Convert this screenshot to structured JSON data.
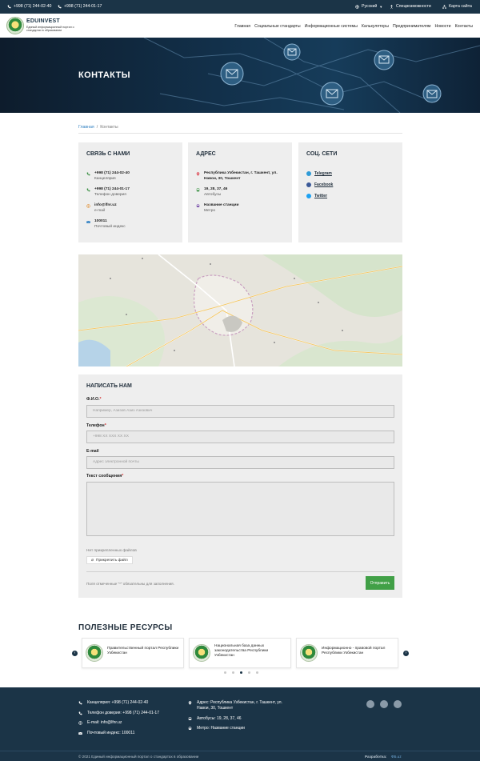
{
  "topbar": {
    "phone1": "+998 (71) 244-02-40",
    "phone2": "+998 (71) 244-01-17",
    "language": "Русский",
    "accessibility": "Спецвозможности",
    "sitemap": "Карта сайта"
  },
  "header": {
    "brand": "EDUINVEST",
    "subtitle": "Единый информационный портал о стандартах в образовании",
    "nav": [
      "Главная",
      "Социальные стандарты",
      "Информационные системы",
      "Калькуляторы",
      "Предпринимателям",
      "Новости",
      "Контакты"
    ]
  },
  "hero": {
    "title": "КОНТАКТЫ"
  },
  "breadcrumb": {
    "home": "Главная",
    "separator": "/",
    "current": "Контакты"
  },
  "contact_card": {
    "title": "СВЯЗЬ С НАМИ",
    "rows": [
      {
        "main": "+998 (71) 244-02-40",
        "sub": "Канцелярия",
        "icon": "phone-icon"
      },
      {
        "main": "+998 (71) 244-01-17",
        "sub": "Телефон доверия",
        "icon": "phone-icon"
      },
      {
        "main": "info@lfnr.uz",
        "sub": "e-mail",
        "icon": "at-icon"
      },
      {
        "main": "100011",
        "sub": "Почтовый индекс",
        "icon": "mail-icon"
      }
    ]
  },
  "address_card": {
    "title": "АДРЕС",
    "rows": [
      {
        "main": "Республика Узбекистан, г. Ташкент, ул. Навои, 30, Тошкент",
        "sub": "",
        "icon": "map-pin-icon"
      },
      {
        "main": "19, 28, 37, 46",
        "sub": "Автобусы",
        "icon": "bus-icon"
      },
      {
        "main": "Название станции",
        "sub": "Метро",
        "icon": "metro-icon"
      }
    ]
  },
  "social_card": {
    "title": "СОЦ. СЕТИ",
    "links": [
      {
        "label": "Telegram",
        "color": "#2f9bd7",
        "icon": "telegram-icon"
      },
      {
        "label": "Facebook",
        "color": "#3b5998",
        "icon": "facebook-icon"
      },
      {
        "label": "Twitter",
        "color": "#1da1f2",
        "icon": "twitter-icon"
      }
    ]
  },
  "form": {
    "title": "НАПИСАТЬ НАМ",
    "name_label": "Ф.И.О.",
    "name_placeholder": "Например, Азизов Азиз Азизович",
    "phone_label": "Телефон",
    "phone_placeholder": "+998 XX XXX XX XX",
    "email_label": "E-mail",
    "email_placeholder": "Адрес электронной почты",
    "message_label": "Текст сообщения",
    "required_mark": "*",
    "files_label": "Нет прикрепленных файлов",
    "attach_label": "Прикрепить файл",
    "note": "Поля отмеченные \"*\" обязательны для заполнения.",
    "submit_label": "Отправить"
  },
  "resources": {
    "title": "ПОЛЕЗНЫЕ РЕСУРСЫ",
    "items": [
      "Правительственный портал Республики Узбекистан",
      "Национальная база данных законодательства Республики Узбекистан",
      "Информационно - правовой портал Республики Узбекистан"
    ],
    "pager_active_index": 2,
    "pager_count": 5
  },
  "footer": {
    "office": "Канцелярия: +998 (71) 244-02-40",
    "trust": "Телефон доверия: +998 (71) 244-01-17",
    "email": "E-mail: info@lfnr.uz",
    "postal": "Почтовый индекс: 100011",
    "address": "Адрес: Республика Узбекистан, г. Ташкент, ул. Навои, 30, Тошкент",
    "buses": "Автобусы: 19, 28, 37, 46",
    "metro": "Метро: Название станции",
    "copyright": "© 2021 Единый информационный портал о стандартах в образовании",
    "developer_label": "Разработка:",
    "developer_name": "ФБ.uz"
  },
  "colors": {
    "dark": "#1b3447",
    "accent": "#41a047",
    "link": "#2f7fc1",
    "required": "#d32f2f"
  }
}
